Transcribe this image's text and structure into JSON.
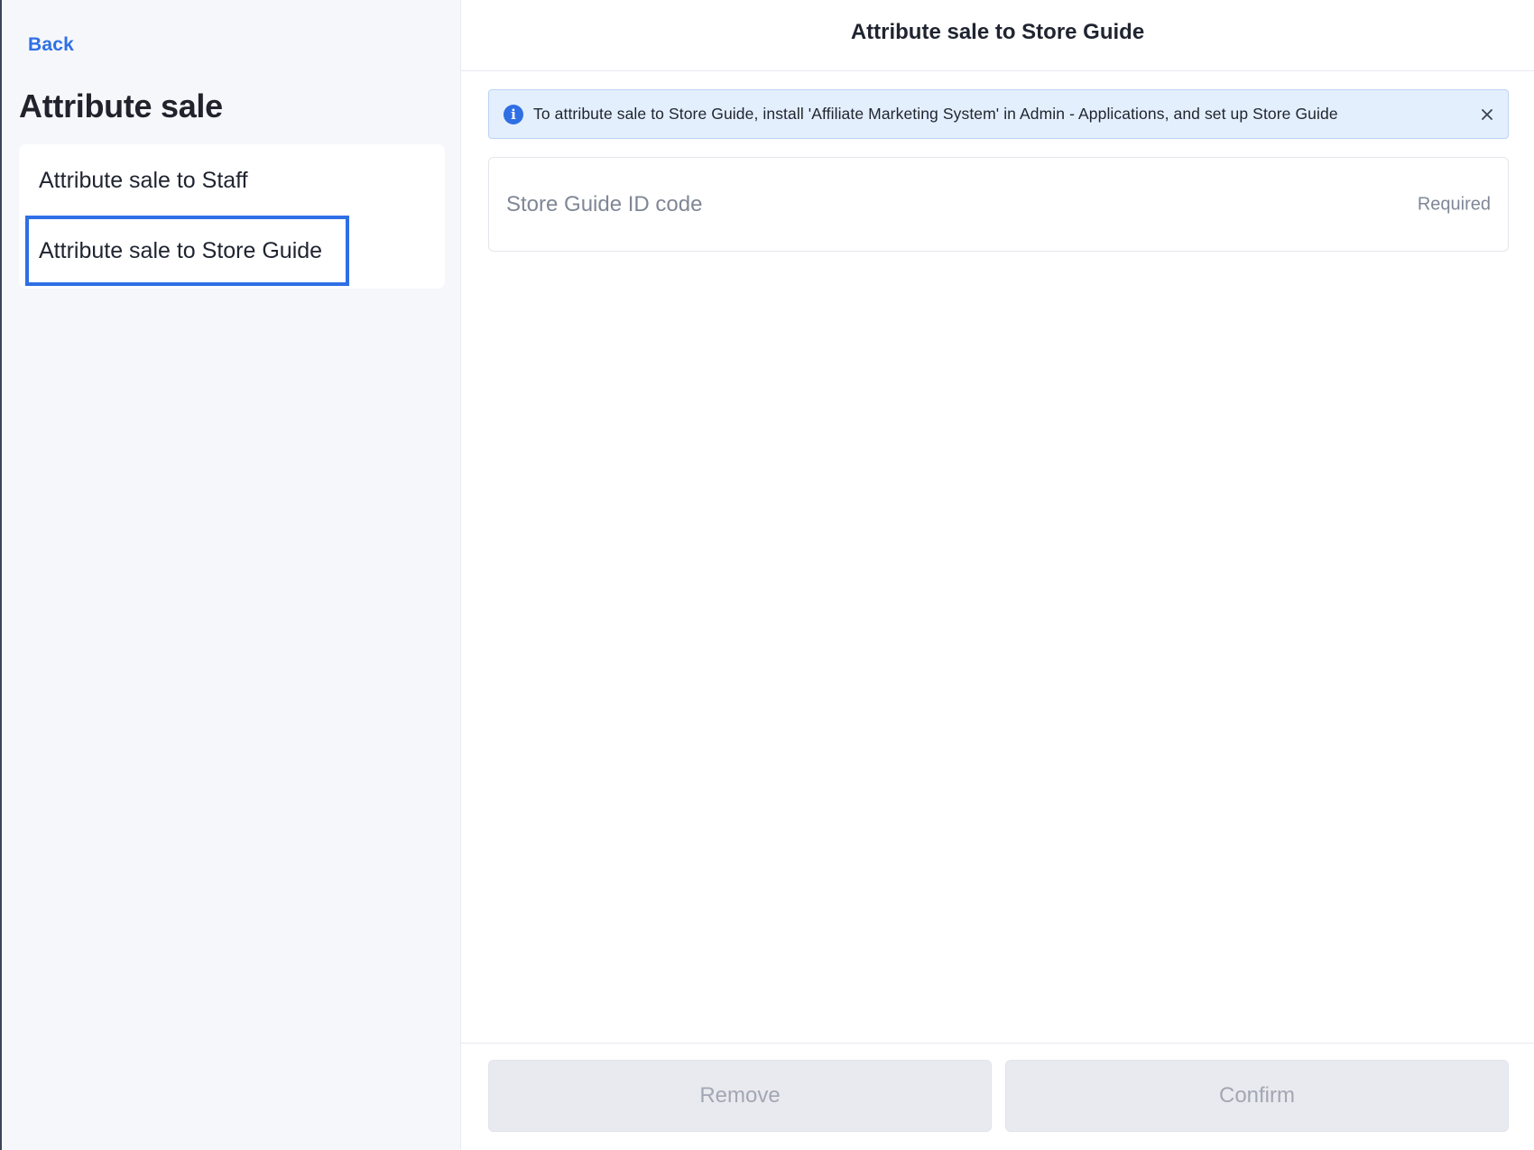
{
  "sidebar": {
    "back_label": "Back",
    "title": "Attribute sale",
    "items": [
      {
        "label": "Attribute sale to Staff",
        "selected": false
      },
      {
        "label": "Attribute sale to Store Guide",
        "selected": true
      }
    ]
  },
  "main": {
    "title": "Attribute sale to Store Guide",
    "banner": {
      "icon": "info-icon",
      "text": "To attribute sale to Store Guide, install 'Affiliate Marketing System' in Admin - Applications, and set up Store Guide",
      "close_icon": "close-icon"
    },
    "field": {
      "label": "Store Guide ID code",
      "required_label": "Required"
    },
    "footer": {
      "remove_label": "Remove",
      "confirm_label": "Confirm"
    }
  },
  "colors": {
    "accent": "#2f6fe4",
    "sidebar_bg": "#f5f7fb",
    "banner_bg": "#e4effd",
    "disabled_button_bg": "#e9eaef",
    "disabled_button_text": "#a1a7b3"
  }
}
